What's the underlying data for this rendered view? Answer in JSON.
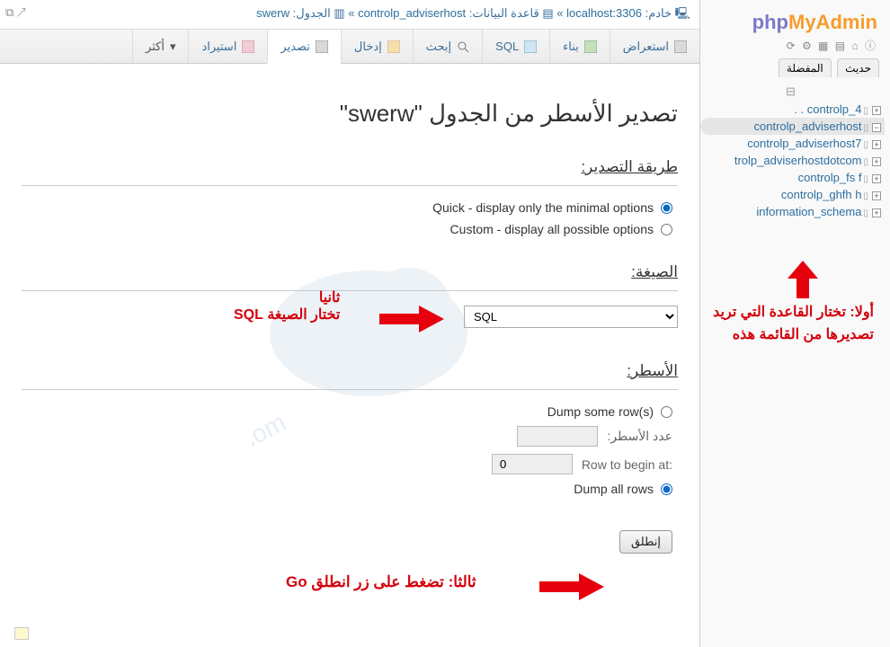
{
  "logo": {
    "php": "php",
    "myadmin": "MyAdmin"
  },
  "sidebar_tabs": {
    "recent": "حديث",
    "fav": "المفضلة"
  },
  "databases": [
    "controlp_4 . .",
    "controlp_adviserhost",
    "controlp_adviserhost7",
    "trolp_adviserhostdotcom",
    "controlp_fs            f",
    "controlp_ghfh          h",
    "information_schema"
  ],
  "sel_db_index": 1,
  "annot_right": "أولا: تختار القاعدة التي تريد تصديرها من القائمة هذه",
  "breadcrumb": {
    "server_label": "خادم:",
    "server": "localhost:3306",
    "db_label": "قاعدة البيانات:",
    "db": "controlp_adviserhost",
    "table_label": "الجدول:",
    "table": "swerw"
  },
  "tabs": {
    "browse": "استعراض",
    "structure": "بناء",
    "sql": "SQL",
    "search": "إبحث",
    "insert": "إدخال",
    "export": "تصدير",
    "import": "استيراد",
    "more": "أكثر"
  },
  "title": "تصدير الأسطر من الجدول \"swerw\"",
  "sections": {
    "method": "طريقة التصدير:",
    "format": "الصيغة:",
    "rows": "الأسطر:"
  },
  "method": {
    "quick": "Quick - display only the minimal options",
    "custom": "Custom - display all possible options"
  },
  "format_value": "SQL",
  "rows": {
    "some": "Dump some row(s)",
    "count_label": "عدد الأسطر:",
    "count_value": "",
    "begin_label": ":Row to begin at",
    "begin_value": "0",
    "all": "Dump all rows"
  },
  "go_label": "إنطلق",
  "annot_mid_l1": "ثانيا",
  "annot_mid_l2": "تختار الصيغة SQL",
  "annot_bot": "ثالثا: تضغط على زر انطلق Go"
}
